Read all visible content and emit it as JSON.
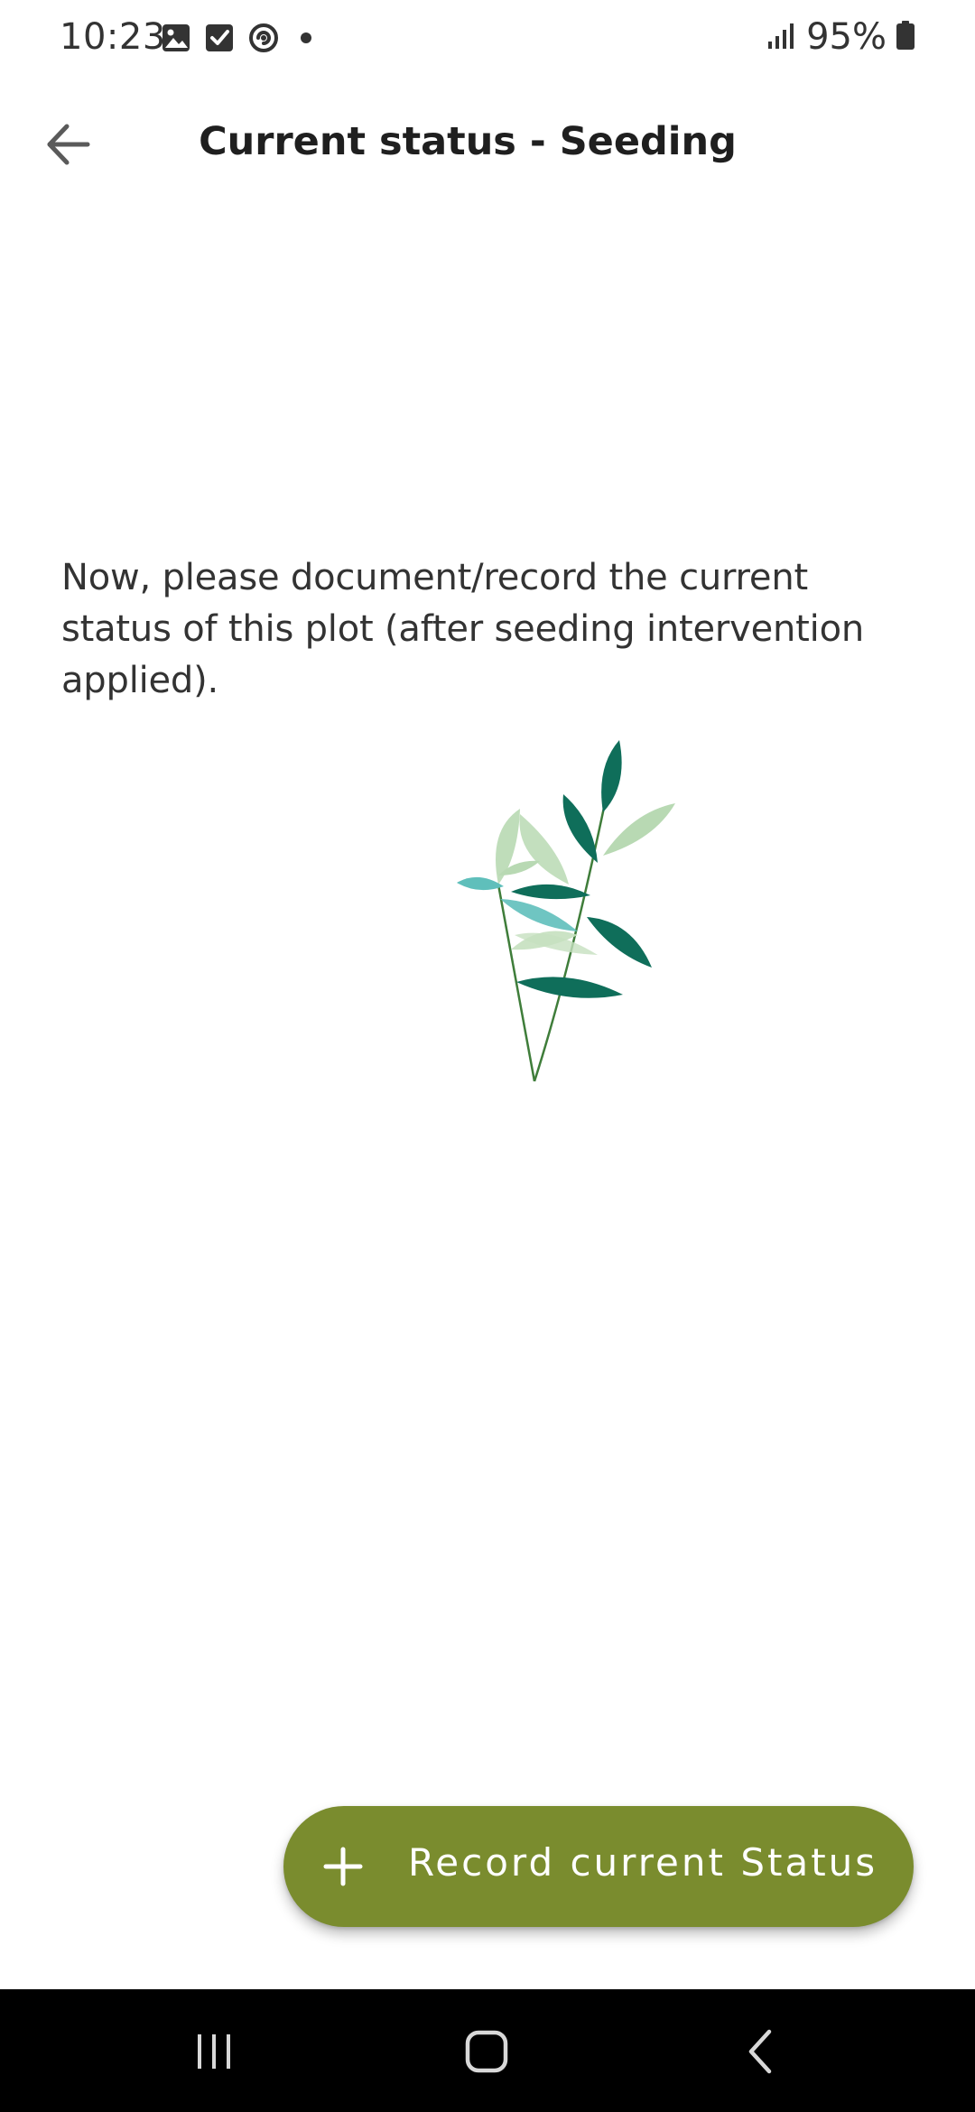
{
  "status_bar": {
    "time": "10:23",
    "battery": "95%",
    "icons_left": [
      "image-icon",
      "checkbox-icon",
      "sync-icon",
      "dot-icon"
    ],
    "icons_right": [
      "signal-icon",
      "battery-icon"
    ]
  },
  "app_bar": {
    "title": "Current status - Seeding",
    "back_icon": "arrow-left-icon"
  },
  "main": {
    "instruction": "Now, please document/record the current status of this plot (after seeding intervention applied).",
    "illustration": "plant-illustration"
  },
  "fab": {
    "icon": "plus-icon",
    "label": "Record current Status",
    "color": "#7a8c2e"
  },
  "nav_bar": {
    "items": [
      "recent-apps-icon",
      "home-icon",
      "back-icon"
    ]
  }
}
